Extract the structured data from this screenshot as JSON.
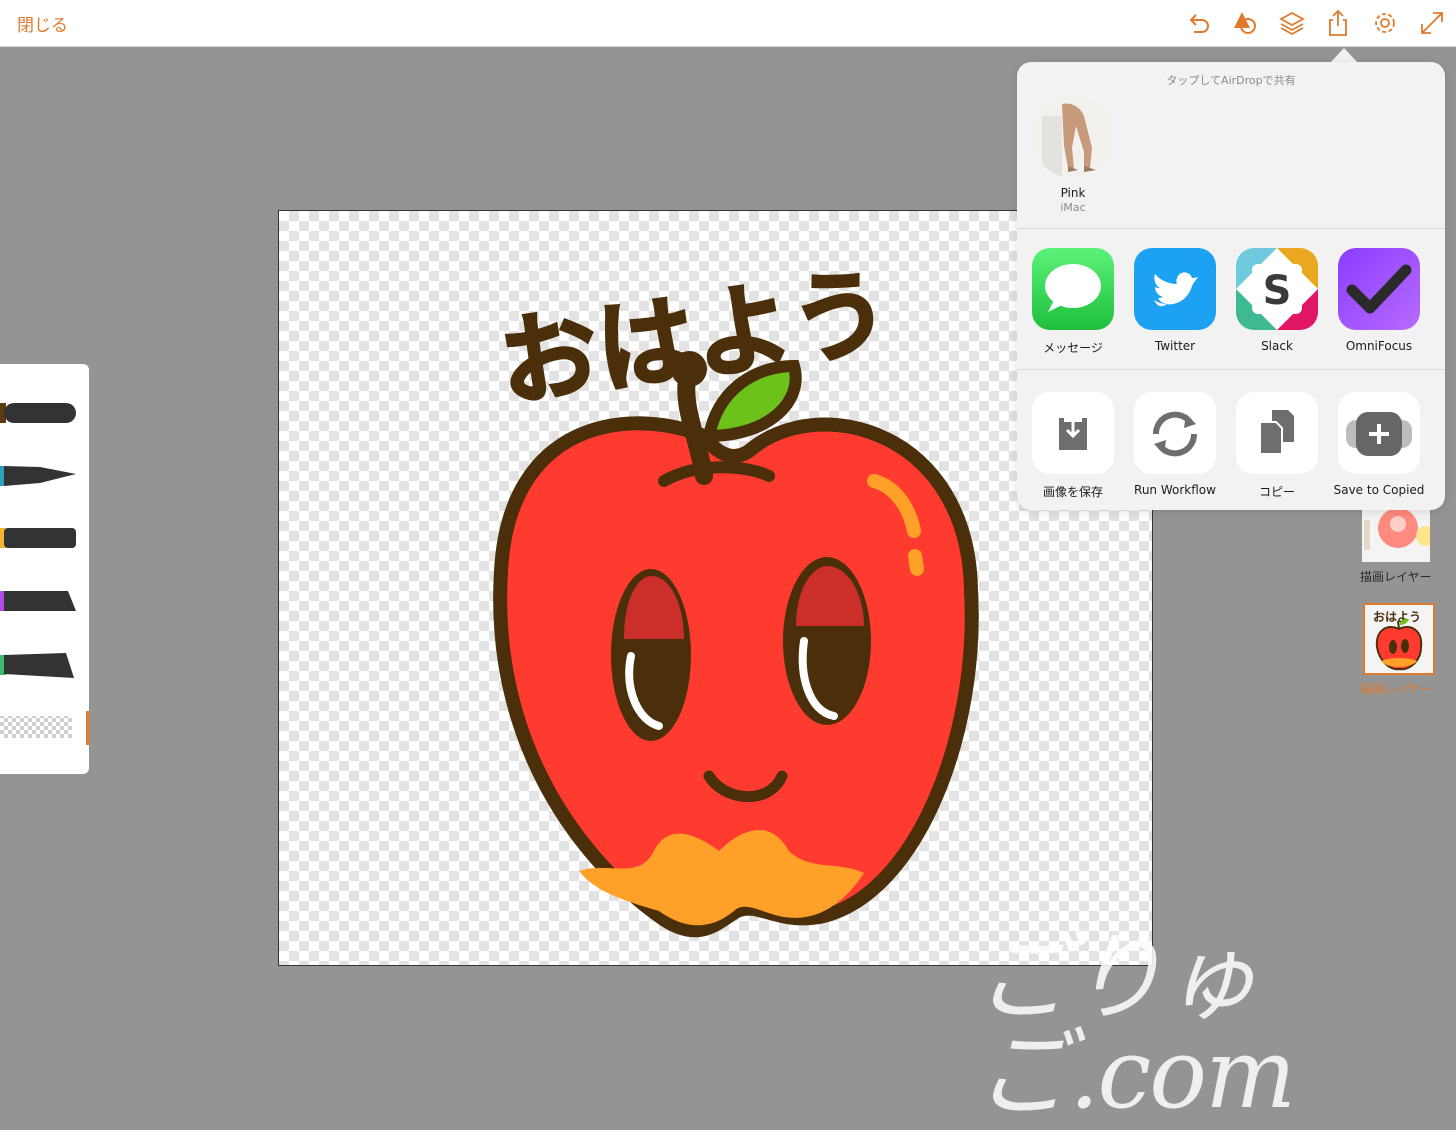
{
  "toolbar": {
    "close_label": "閉じる",
    "icons": [
      "undo-icon",
      "shapes-icon",
      "layers-icon",
      "share-icon",
      "settings-icon",
      "fullscreen-icon"
    ]
  },
  "colors": {
    "accent": "#e07a2c",
    "apple_red": "#ff3b30",
    "outline_brown": "#4a2f0a",
    "leaf_green": "#6cc21a",
    "apple_bottom_orange": "#ffa028"
  },
  "canvas": {
    "artwork_text": "おはよう"
  },
  "brushes": [
    {
      "name": "brush-1",
      "color": "#5a3b12"
    },
    {
      "name": "brush-2",
      "color": "#2aa3b8"
    },
    {
      "name": "brush-3",
      "color": "#f2b531"
    },
    {
      "name": "brush-4",
      "color": "#b04ae8"
    },
    {
      "name": "brush-5",
      "color": "#3eb86a"
    },
    {
      "name": "eraser",
      "color": "#cccccc"
    }
  ],
  "share_sheet": {
    "airdrop_title": "タップしてAirDropで共有",
    "airdrop_device": {
      "name": "Pink",
      "type": "iMac"
    },
    "apps": [
      {
        "label": "メッセージ",
        "icon": "messages-icon",
        "color": "#34c759"
      },
      {
        "label": "Twitter",
        "icon": "twitter-icon",
        "color": "#1da1f2"
      },
      {
        "label": "Slack",
        "icon": "slack-icon",
        "color": "#ffffff"
      },
      {
        "label": "OmniFocus",
        "icon": "omnifocus-icon",
        "color": "#9b4dff"
      }
    ],
    "actions": [
      {
        "label": "画像を保存",
        "icon": "save-image-icon"
      },
      {
        "label": "Run Workflow",
        "icon": "workflow-icon"
      },
      {
        "label": "コピー",
        "icon": "copy-icon"
      },
      {
        "label": "Save to Copied",
        "icon": "save-to-copied-icon"
      }
    ]
  },
  "layers": [
    {
      "label": "描画レイヤー",
      "selected": false
    },
    {
      "label": "描画レイヤー",
      "selected": true
    }
  ],
  "watermark": "ごりゅご.com"
}
